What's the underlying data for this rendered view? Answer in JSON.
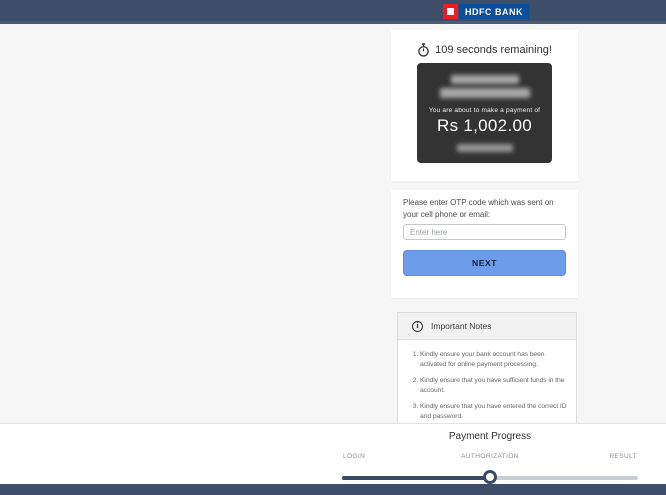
{
  "header": {
    "logo": {
      "bank_name": "HDFC BANK"
    }
  },
  "session": {
    "timer_text": "109 seconds remaining!"
  },
  "payment": {
    "intro_text": "You are about to make a payment of",
    "amount": "Rs 1,002.00"
  },
  "otp_form": {
    "prompt": "Please enter OTP code which was sent on your cell phone or email:",
    "input_placeholder": "Enter here",
    "next_button_label": "NEXT"
  },
  "important_notes": {
    "title": "Important Notes",
    "items": [
      "Kindly ensure your bank account has been activated for online payment processing.",
      "Kindly ensure that you have sufficient funds in the account.",
      "Kindly ensure that you have entered the correct ID and password."
    ]
  },
  "payment_progress": {
    "title": "Payment Progress",
    "steps": [
      "LOGIN",
      "AUTHORIZATION",
      "RESULT"
    ],
    "current_step": "AUTHORIZATION",
    "progress_percent": 50
  },
  "colors": {
    "header_bar": "#3E4E68",
    "hdfc_logo_red": "#EC1C24",
    "hdfc_logo_blue": "#0C4E9C",
    "page_background": "#F6F6F6",
    "payment_box_background": "#333333",
    "next_button": "#6D9CEA",
    "progress_track_active": "#3A4A63",
    "progress_track_inactive": "#C9CDD5"
  }
}
